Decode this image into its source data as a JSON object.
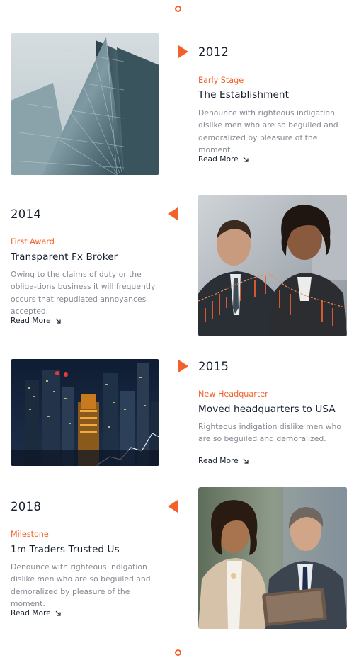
{
  "timeline": {
    "entries": [
      {
        "year": "2012",
        "stage": "Early Stage",
        "title": "The Establishment",
        "description": "Denounce with righteous indigation dislike men who are so beguiled and demoralized by pleasure of the moment.",
        "read_more": "Read More",
        "image_icon": "office-tower-photo"
      },
      {
        "year": "2014",
        "stage": "First Award",
        "title": "Transparent Fx Broker",
        "description": "Owing to the claims of duty or the obliga-tions business it will frequently occurs that repudiated annoyances accepted.",
        "read_more": "Read More",
        "image_icon": "business-people-photo"
      },
      {
        "year": "2015",
        "stage": "New Headquarter",
        "title": "Moved headquarters to USA",
        "description": "Righteous indigation dislike men who are so beguiled and demoralized.",
        "read_more": "Read More",
        "image_icon": "night-city-photo"
      },
      {
        "year": "2018",
        "stage": "Milestone",
        "title": "1m Traders Trusted Us",
        "description": "Denounce with righteous indigation dislike men who are so beguiled and demoralized by pleasure of the moment.",
        "read_more": "Read More",
        "image_icon": "traders-tablet-photo"
      }
    ]
  },
  "colors": {
    "accent": "#f2612b",
    "heading": "#16202e",
    "body_text": "#858892",
    "timeline_line": "#dddde0"
  }
}
